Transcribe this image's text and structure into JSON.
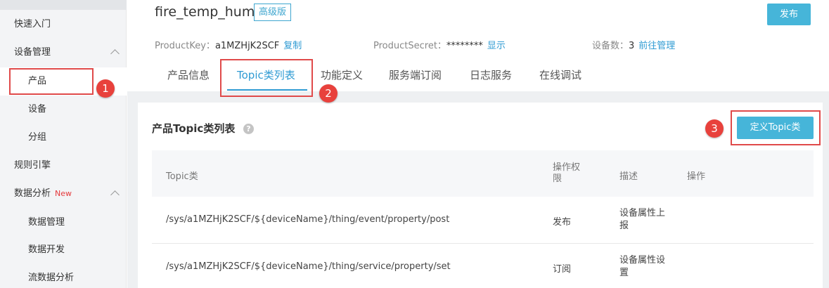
{
  "sidebar": {
    "items": [
      {
        "label": "快速入门"
      },
      {
        "label": "设备管理"
      },
      {
        "label": "产品"
      },
      {
        "label": "设备"
      },
      {
        "label": "分组"
      },
      {
        "label": "规则引擎"
      },
      {
        "label": "数据分析",
        "badge": "New"
      },
      {
        "label": "数据管理"
      },
      {
        "label": "数据开发"
      },
      {
        "label": "流数据分析"
      }
    ]
  },
  "header": {
    "title": "fire_temp_hum",
    "tag": "高级版",
    "publish_label": "发布",
    "product_key_label": "ProductKey：",
    "product_key_value": "a1MZHjK2SCF",
    "copy_label": "复制",
    "product_secret_label": "ProductSecret：",
    "product_secret_value": "********",
    "show_label": "显示",
    "device_count_label": "设备数：",
    "device_count_value": "3",
    "manage_label": "前往管理"
  },
  "tabs": [
    {
      "label": "产品信息"
    },
    {
      "label": "Topic类列表"
    },
    {
      "label": "功能定义"
    },
    {
      "label": "服务端订阅"
    },
    {
      "label": "日志服务"
    },
    {
      "label": "在线调试"
    }
  ],
  "annotations": [
    "1",
    "2",
    "3"
  ],
  "section": {
    "title": "产品Topic类列表",
    "help_icon": "?",
    "define_button": "定义Topic类"
  },
  "table": {
    "headers": [
      "Topic类",
      "操作权限",
      "描述",
      "操作"
    ],
    "rows": [
      {
        "topic": "/sys/a1MZHjK2SCF/${deviceName}/thing/event/property/post",
        "permission": "发布",
        "desc": "设备属性上报",
        "action": ""
      },
      {
        "topic": "/sys/a1MZHjK2SCF/${deviceName}/thing/service/property/set",
        "permission": "订阅",
        "desc": "设备属性设置",
        "action": ""
      }
    ]
  },
  "colors": {
    "accent": "#2f9bd3",
    "button": "#46b5d9",
    "highlight": "#e04a4a",
    "badge_new": "#e4393c"
  }
}
